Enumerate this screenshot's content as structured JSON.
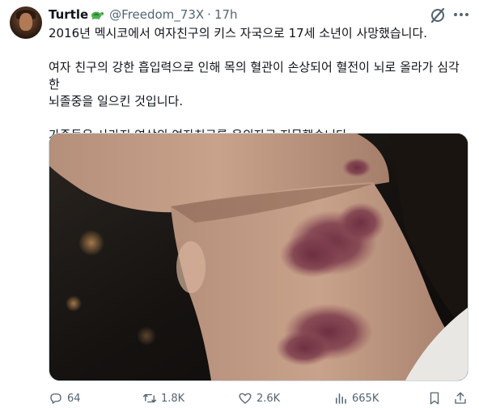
{
  "tweet": {
    "author_name": "Turtle",
    "author_handle": "@Freedom_73X",
    "separator": "·",
    "timestamp": "17h",
    "lines": [
      "2016년 멕시코에서 여자친구의 키스 자국으로 17세 소년이 사망했습니다.",
      "여자 친구의 강한 흡입력으로 인해 목의 혈관이 손상되어 혈전이 뇌로 올라가 심각한",
      "뇌졸중을 일으킨 것입니다.",
      "가족들은 사라진 연상의 여자친구를 용의자로 지목했습니다."
    ]
  },
  "actions": {
    "replies": "64",
    "retweets": "1.8K",
    "likes": "2.6K",
    "views": "665K"
  },
  "icons": {
    "verified_badge": "turtle-emoji-icon",
    "grok": "grok-icon",
    "more": "more-icon",
    "reply": "reply-icon",
    "retweet": "retweet-icon",
    "like": "heart-icon",
    "views": "views-chart-icon",
    "bookmark": "bookmark-icon",
    "share": "share-icon"
  },
  "colors": {
    "text_primary": "#0f1419",
    "text_secondary": "#536471",
    "border": "#cfd9de"
  }
}
